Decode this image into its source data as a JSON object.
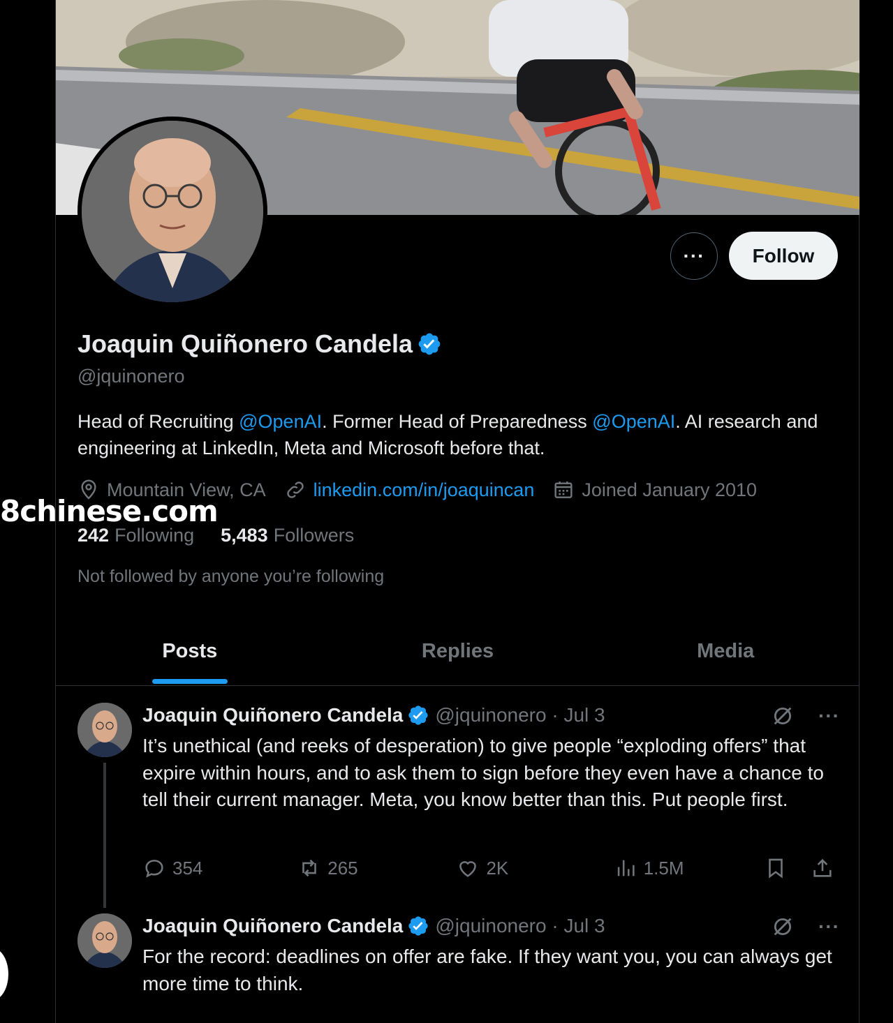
{
  "profile": {
    "name": "Joaquin Quiñonero Candela",
    "handle": "@jquinonero",
    "bio": {
      "t1": "Head of Recruiting ",
      "m1": "@OpenAI",
      "t2": ".  Former Head of Preparedness ",
      "m2": "@OpenAI",
      "t3": ".  AI research and engineering at LinkedIn, Meta and Microsoft before that."
    },
    "location": "Mountain View, CA",
    "website": "linkedin.com/in/joaquincan",
    "joined": "Joined January 2010",
    "following_count": "242",
    "following_label": "Following",
    "followers_count": "5,483",
    "followers_label": "Followers",
    "not_followed": "Not followed by anyone you’re following"
  },
  "buttons": {
    "more": "···",
    "follow": "Follow"
  },
  "tabs": [
    {
      "label": "Posts",
      "active": true
    },
    {
      "label": "Replies",
      "active": false
    },
    {
      "label": "Media",
      "active": false
    }
  ],
  "posts": [
    {
      "name": "Joaquin Quiñonero Candela",
      "handle": "@jquinonero",
      "date": "Jul 3",
      "text": "It’s unethical (and reeks of desperation) to give people “exploding offers” that expire within hours, and to ask them to sign before they even have a chance to tell their current manager. Meta, you know better than this. Put people first.",
      "replies": "354",
      "reposts": "265",
      "likes": "2K",
      "views": "1.5M"
    },
    {
      "name": "Joaquin Quiñonero Candela",
      "handle": "@jquinonero",
      "date": "Jul 3",
      "text": "For the record: deadlines on offer are fake. If they want you, you can always get more time to think."
    }
  ],
  "watermark": "8chinese.com",
  "colors": {
    "accent": "#1d9bf0",
    "background": "#000000",
    "text": "#e7e9ea",
    "muted": "#71767b"
  },
  "icons": [
    "location-icon",
    "link-icon",
    "calendar-icon",
    "verified-icon",
    "reply-icon",
    "repost-icon",
    "like-icon",
    "views-icon",
    "bookmark-icon",
    "share-icon",
    "grok-icon"
  ]
}
